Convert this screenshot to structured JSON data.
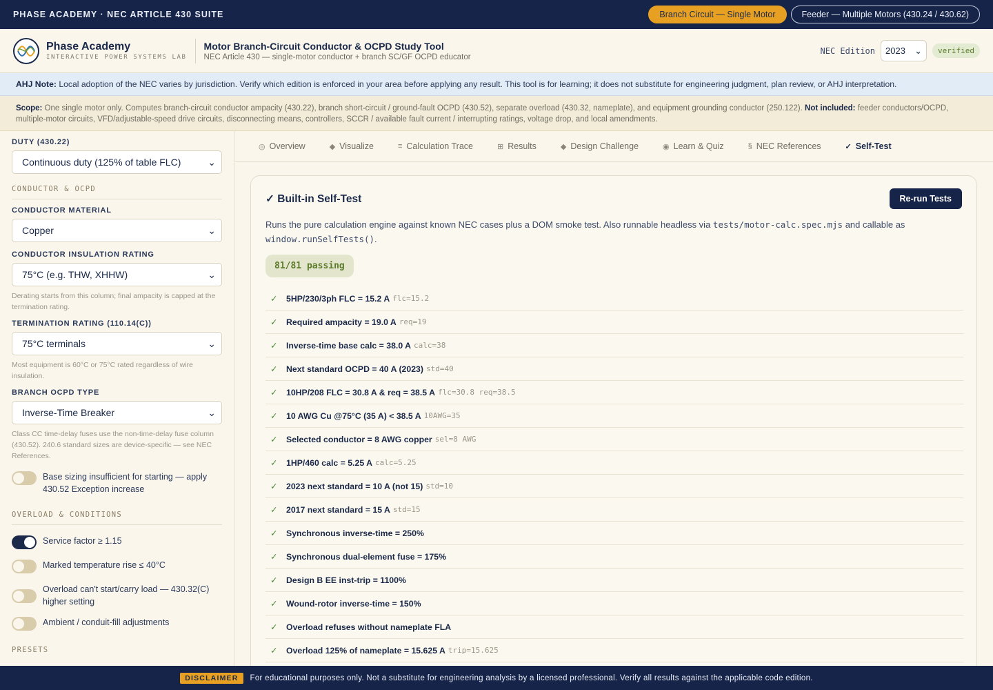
{
  "topbar": {
    "brand": "PHASE ACADEMY · NEC ARTICLE 430 SUITE",
    "modes": [
      "Branch Circuit — Single Motor",
      "Feeder — Multiple Motors (430.24 / 430.62)"
    ]
  },
  "header": {
    "brand_name": "Phase Academy",
    "brand_sub": "INTERACTIVE POWER SYSTEMS LAB",
    "title": "Motor Branch-Circuit Conductor & OCPD Study Tool",
    "subtitle": "NEC Article 430 — single-motor conductor + branch SC/GF OCPD educator",
    "edition_label": "NEC Edition",
    "edition_value": "2023",
    "verified": "verified"
  },
  "ahj": {
    "label": "AHJ Note:",
    "text": "Local adoption of the NEC varies by jurisdiction. Verify which edition is enforced in your area before applying any result. This tool is for learning; it does not substitute for engineering judgment, plan review, or AHJ interpretation."
  },
  "scope": {
    "label": "Scope:",
    "text": "One single motor only. Computes branch-circuit conductor ampacity (430.22), branch short-circuit / ground-fault OCPD (430.52), separate overload (430.32, nameplate), and equipment grounding conductor (250.122).",
    "excl_label": "Not included:",
    "excl_text": "feeder conductors/OCPD, multiple-motor circuits, VFD/adjustable-speed drive circuits, disconnecting means, controllers, SCCR / available fault current / interrupting ratings, voltage drop, and local amendments."
  },
  "sidebar": {
    "duty_label": "DUTY (430.22)",
    "duty_value": "Continuous duty (125% of table FLC)",
    "section_conductor": "CONDUCTOR & OCPD",
    "material_label": "CONDUCTOR MATERIAL",
    "material_value": "Copper",
    "insulation_label": "CONDUCTOR INSULATION RATING",
    "insulation_value": "75°C (e.g. THW, XHHW)",
    "insulation_help": "Derating starts from this column; final ampacity is capped at the termination rating.",
    "termination_label": "TERMINATION RATING (110.14(C))",
    "termination_value": "75°C terminals",
    "termination_help": "Most equipment is 60°C or 75°C rated regardless of wire insulation.",
    "ocpd_label": "BRANCH OCPD TYPE",
    "ocpd_value": "Inverse-Time Breaker",
    "ocpd_help": "Class CC time-delay fuses use the non-time-delay fuse column (430.52). 240.6 standard sizes are device-specific — see NEC References.",
    "exception_toggle": "Base sizing insufficient for starting — apply 430.52 Exception increase",
    "section_overload": "OVERLOAD & CONDITIONS",
    "toggles": [
      {
        "label": "Service factor ≥ 1.15",
        "on": true
      },
      {
        "label": "Marked temperature rise ≤ 40°C",
        "on": false
      },
      {
        "label": "Overload can't start/carry load — 430.32(C) higher setting",
        "on": false
      },
      {
        "label": "Ambient / conduit-fill adjustments",
        "on": false
      }
    ],
    "section_presets": "PRESETS"
  },
  "tabs": [
    {
      "icon": "◎",
      "label": "Overview"
    },
    {
      "icon": "◆",
      "label": "Visualize"
    },
    {
      "icon": "≡",
      "label": "Calculation Trace"
    },
    {
      "icon": "⊞",
      "label": "Results"
    },
    {
      "icon": "◆",
      "label": "Design Challenge"
    },
    {
      "icon": "◉",
      "label": "Learn & Quiz"
    },
    {
      "icon": "§",
      "label": "NEC References"
    },
    {
      "icon": "✓",
      "label": "Self-Test"
    }
  ],
  "selftest": {
    "title": "✓ Built-in Self-Test",
    "rerun": "Re-run Tests",
    "desc_1": "Runs the pure calculation engine against known NEC cases plus a DOM smoke test. Also runnable headless via",
    "desc_code1": "tests/motor-calc.spec.mjs",
    "desc_2": "and callable as",
    "desc_code2": "window.runSelfTests()",
    "desc_3": ".",
    "passing": "81/81 passing",
    "tests": [
      {
        "name": "5HP/230/3ph FLC = 15.2 A",
        "val": "flc=15.2"
      },
      {
        "name": "Required ampacity = 19.0 A",
        "val": "req=19"
      },
      {
        "name": "Inverse-time base calc = 38.0 A",
        "val": "calc=38"
      },
      {
        "name": "Next standard OCPD = 40 A (2023)",
        "val": "std=40"
      },
      {
        "name": "10HP/208 FLC = 30.8 A & req = 38.5 A",
        "val": "flc=30.8 req=38.5"
      },
      {
        "name": "10 AWG Cu @75°C (35 A) < 38.5 A",
        "val": "10AWG=35"
      },
      {
        "name": "Selected conductor = 8 AWG copper",
        "val": "sel=8 AWG"
      },
      {
        "name": "1HP/460 calc = 5.25 A",
        "val": "calc=5.25"
      },
      {
        "name": "2023 next standard = 10 A (not 15)",
        "val": "std=10"
      },
      {
        "name": "2017 next standard = 15 A",
        "val": "std=15"
      },
      {
        "name": "Synchronous inverse-time = 250%",
        "val": ""
      },
      {
        "name": "Synchronous dual-element fuse = 175%",
        "val": ""
      },
      {
        "name": "Design B EE inst-trip = 1100%",
        "val": ""
      },
      {
        "name": "Wound-rotor inverse-time = 150%",
        "val": ""
      },
      {
        "name": "Overload refuses without nameplate FLA",
        "val": ""
      },
      {
        "name": "Overload 125% of nameplate = 15.625 A",
        "val": "trip=15.625"
      }
    ]
  },
  "footer": {
    "badge": "DISCLAIMER",
    "text": "For educational purposes only. Not a substitute for engineering analysis by a licensed professional. Verify all results against the applicable code edition."
  }
}
